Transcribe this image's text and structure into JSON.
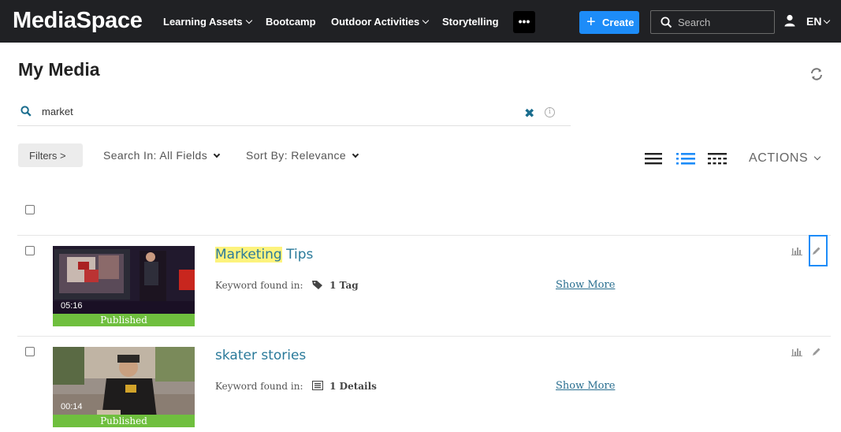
{
  "header": {
    "brand": "MediaSpace",
    "nav": [
      {
        "label": "Learning Assets",
        "has_dropdown": true
      },
      {
        "label": "Bootcamp",
        "has_dropdown": false
      },
      {
        "label": "Outdoor Activities",
        "has_dropdown": true
      },
      {
        "label": "Storytelling",
        "has_dropdown": false
      }
    ],
    "more_label": "•••",
    "create_plus": "+",
    "create_label": "Create",
    "search_placeholder": "Search",
    "language": "EN"
  },
  "page": {
    "title": "My Media",
    "search_query": "market",
    "filters_label": "Filters  >",
    "search_in": "Search In: All Fields",
    "sort_by": "Sort By: Relevance",
    "actions_label": "ACTIONS"
  },
  "entries": [
    {
      "title_highlight": "Marketing",
      "title_rest": " Tips",
      "duration": "05:16",
      "status": "Published",
      "keyword_label": "Keyword found in:",
      "match_icon": "tag-icon",
      "match_value": "1 Tag",
      "show_more": "Show More"
    },
    {
      "title_highlight": "",
      "title_rest": "skater stories",
      "duration": "00:14",
      "status": "Published",
      "keyword_label": "Keyword found in:",
      "match_icon": "details-icon",
      "match_value": "1 Details",
      "show_more": "Show More"
    }
  ],
  "colors": {
    "topbar": "#202124",
    "create_button": "#1d8cf8",
    "published_badge": "#6fbf3e",
    "link": "#2a7a9a",
    "highlight": "#fdf37d"
  }
}
